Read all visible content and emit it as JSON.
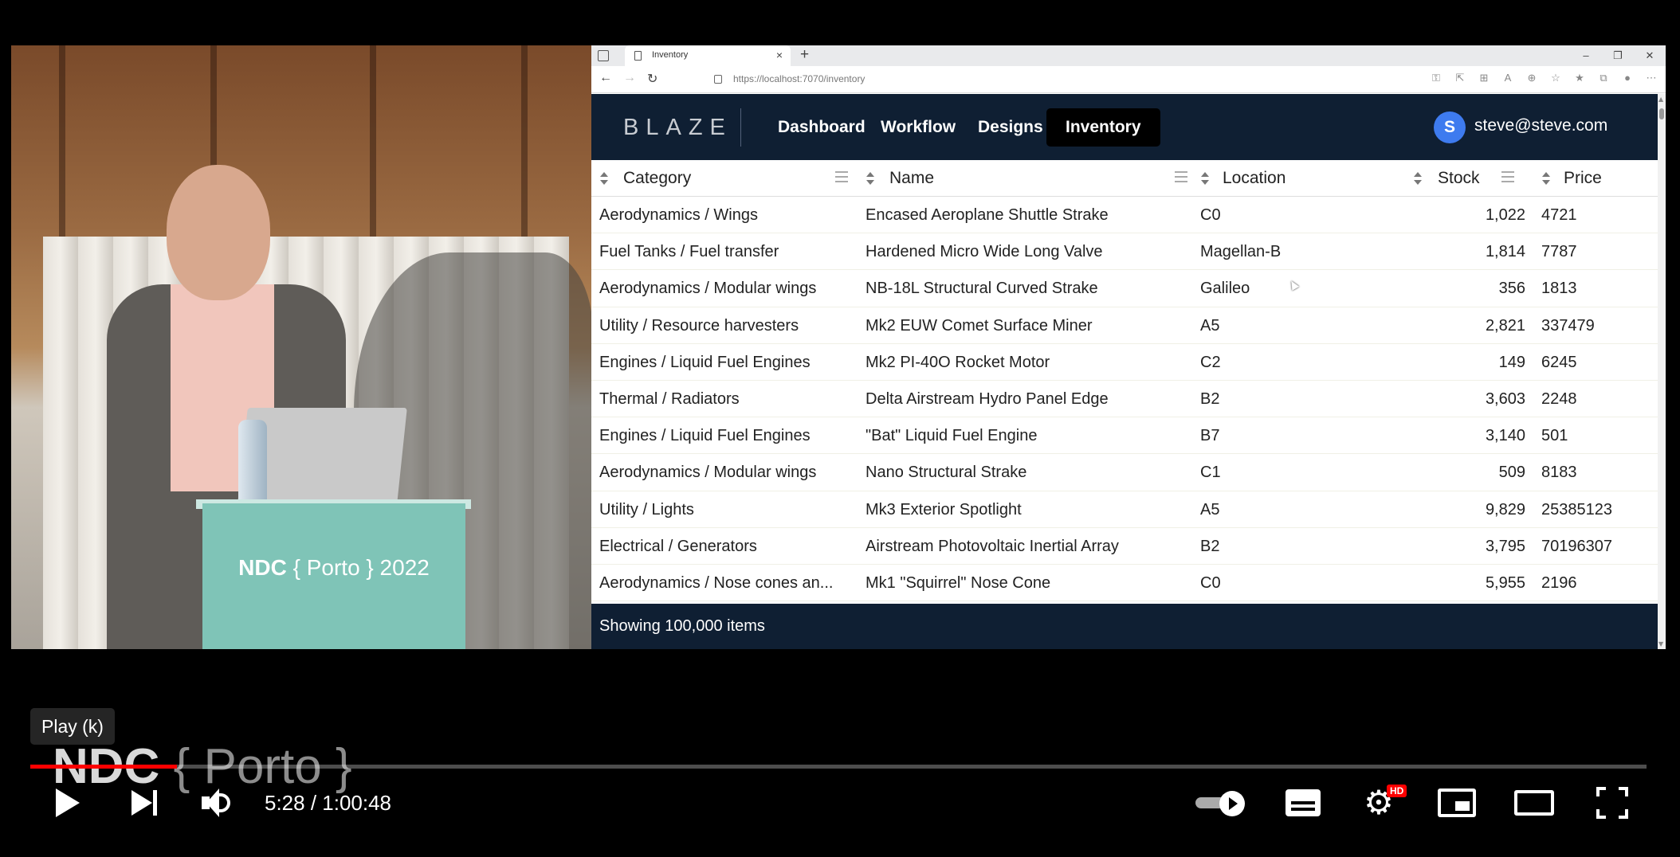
{
  "video": {
    "podium_text_bold": "NDC",
    "podium_text_light": "{ Porto } 2022"
  },
  "browser": {
    "tab_title": "Inventory",
    "tab_close": "×",
    "new_tab": "+",
    "url": "https://localhost:7070/inventory",
    "window_controls": [
      "–",
      "❐",
      "✕"
    ]
  },
  "app": {
    "logo": "BLAZE",
    "nav": [
      {
        "label": "Dashboard",
        "active": false
      },
      {
        "label": "Workflow",
        "active": false
      },
      {
        "label": "Designs",
        "active": false
      },
      {
        "label": "Inventory",
        "active": true
      }
    ],
    "user": {
      "initial": "S",
      "email": "steve@steve.com"
    },
    "columns": [
      "Category",
      "Name",
      "Location",
      "Stock",
      "Price"
    ],
    "rows": [
      {
        "category": "Aerodynamics / Wings",
        "name": "Encased Aeroplane Shuttle Strake",
        "location": "C0",
        "stock": "1,022",
        "price": "4721"
      },
      {
        "category": "Fuel Tanks / Fuel transfer",
        "name": "Hardened Micro Wide Long Valve",
        "location": "Magellan-B",
        "stock": "1,814",
        "price": "7787"
      },
      {
        "category": "Aerodynamics / Modular wings",
        "name": "NB-18L Structural Curved Strake",
        "location": "Galileo",
        "stock": "356",
        "price": "1813"
      },
      {
        "category": "Utility / Resource harvesters",
        "name": "Mk2 EUW Comet Surface Miner",
        "location": "A5",
        "stock": "2,821",
        "price": "337479"
      },
      {
        "category": "Engines / Liquid Fuel Engines",
        "name": "Mk2 PI-40O Rocket Motor",
        "location": "C2",
        "stock": "149",
        "price": "6245"
      },
      {
        "category": "Thermal / Radiators",
        "name": "Delta Airstream Hydro Panel Edge",
        "location": "B2",
        "stock": "3,603",
        "price": "2248"
      },
      {
        "category": "Engines / Liquid Fuel Engines",
        "name": "\"Bat\" Liquid Fuel Engine",
        "location": "B7",
        "stock": "3,140",
        "price": "501"
      },
      {
        "category": "Aerodynamics / Modular wings",
        "name": "Nano Structural Strake",
        "location": "C1",
        "stock": "509",
        "price": "8183"
      },
      {
        "category": "Utility / Lights",
        "name": "Mk3 Exterior Spotlight",
        "location": "A5",
        "stock": "9,829",
        "price": "25385123"
      },
      {
        "category": "Electrical / Generators",
        "name": "Airstream Photovoltaic Inertial Array",
        "location": "B2",
        "stock": "3,795",
        "price": "70196307"
      },
      {
        "category": "Aerodynamics / Nose cones an...",
        "name": "Mk1 \"Squirrel\" Nose Cone",
        "location": "C0",
        "stock": "5,955",
        "price": "2196"
      }
    ],
    "footer": "Showing 100,000 items"
  },
  "player": {
    "tooltip": "Play (k)",
    "watermark_bold": "NDC",
    "watermark_light": "{ Porto }",
    "time": "5:28 / 1:00:48",
    "progress_fraction": 0.0905,
    "hd_badge": "HD",
    "colors": {
      "progress": "#ff0000",
      "app_header": "#0f1f33",
      "avatar": "#3e7bef"
    }
  }
}
